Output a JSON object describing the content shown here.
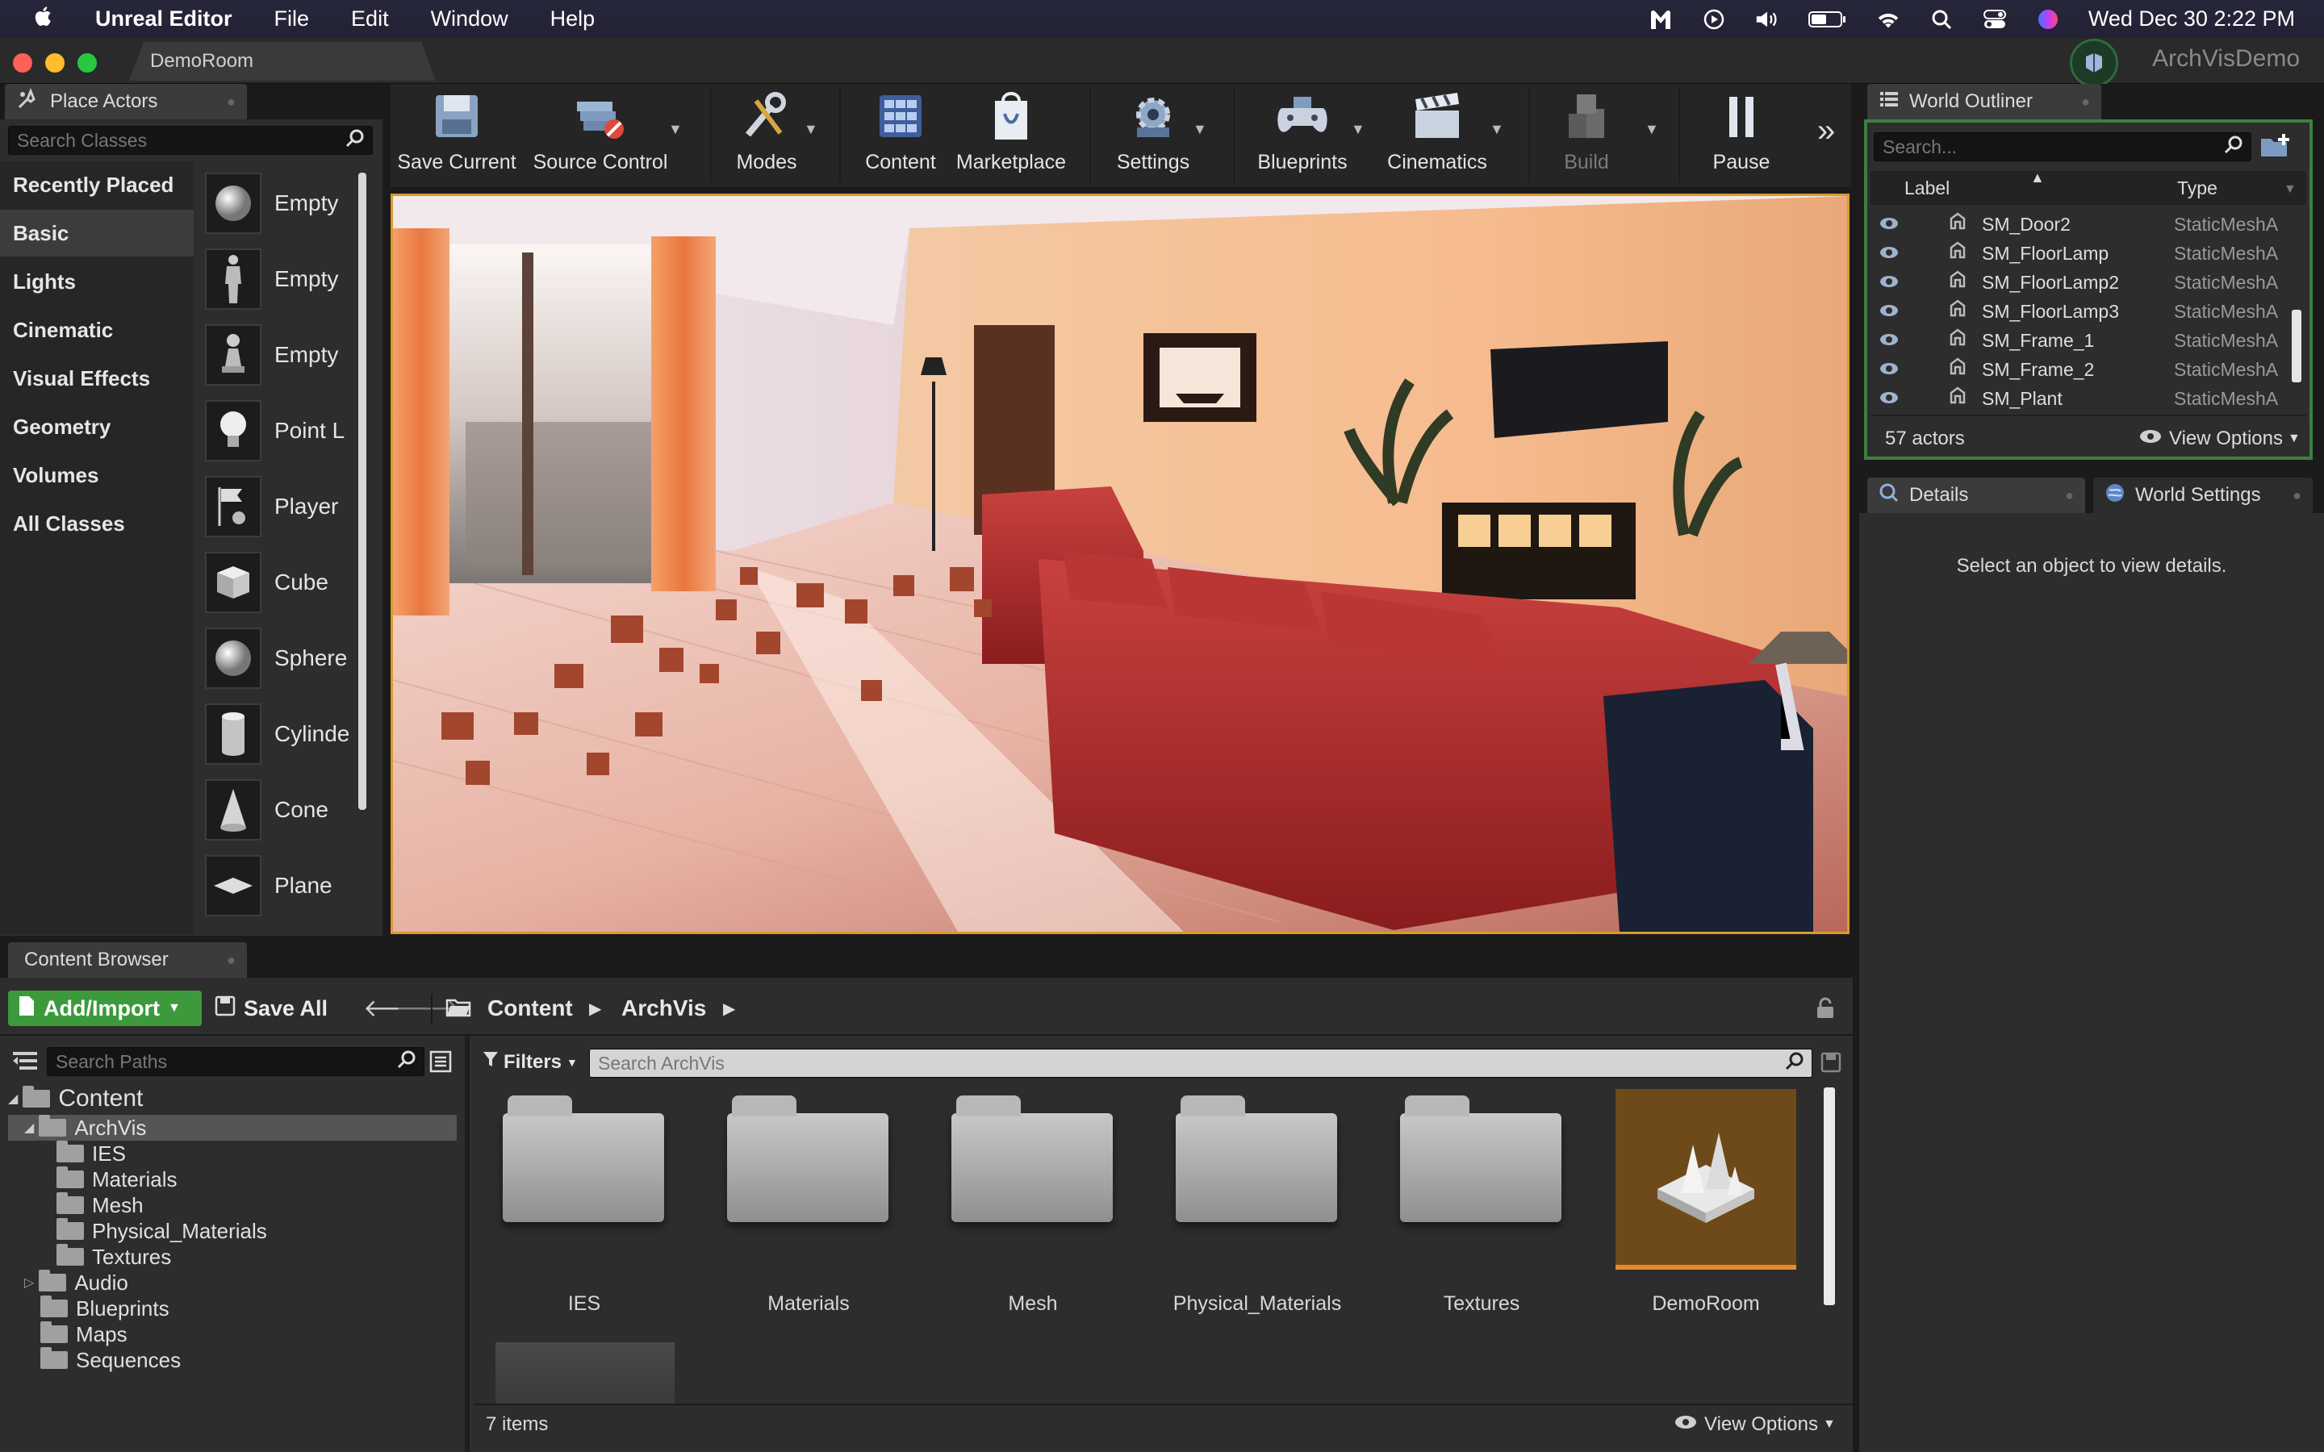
{
  "menubar": {
    "app": "Unreal Editor",
    "items": [
      "File",
      "Edit",
      "Window",
      "Help"
    ],
    "datetime": "Wed Dec 30  2:22 PM"
  },
  "window": {
    "doc_tab": "DemoRoom",
    "project": "ArchVisDemo"
  },
  "place_actors": {
    "tab": "Place Actors",
    "search_placeholder": "Search Classes",
    "categories": [
      "Recently Placed",
      "Basic",
      "Lights",
      "Cinematic",
      "Visual Effects",
      "Geometry",
      "Volumes",
      "All Classes"
    ],
    "selected_category": "Basic",
    "items": [
      "Empty",
      "Empty",
      "Empty",
      "Point L",
      "Player",
      "Cube",
      "Sphere",
      "Cylinde",
      "Cone",
      "Plane"
    ]
  },
  "toolbar": {
    "save": "Save Current",
    "source": "Source Control",
    "modes": "Modes",
    "content": "Content",
    "marketplace": "Marketplace",
    "settings": "Settings",
    "blueprints": "Blueprints",
    "cinematics": "Cinematics",
    "build": "Build",
    "pause": "Pause"
  },
  "outliner": {
    "tab": "World Outliner",
    "search_placeholder": "Search...",
    "col_label": "Label",
    "col_type": "Type",
    "rows": [
      {
        "name": "SM_Door2",
        "type": "StaticMeshA"
      },
      {
        "name": "SM_FloorLamp",
        "type": "StaticMeshA"
      },
      {
        "name": "SM_FloorLamp2",
        "type": "StaticMeshA"
      },
      {
        "name": "SM_FloorLamp3",
        "type": "StaticMeshA"
      },
      {
        "name": "SM_Frame_1",
        "type": "StaticMeshA"
      },
      {
        "name": "SM_Frame_2",
        "type": "StaticMeshA"
      },
      {
        "name": "SM_Plant",
        "type": "StaticMeshA"
      }
    ],
    "count": "57 actors",
    "view_options": "View Options"
  },
  "details": {
    "tab": "Details",
    "world_settings_tab": "World Settings",
    "empty_msg": "Select an object to view details."
  },
  "content_browser": {
    "tab": "Content Browser",
    "add_import": "Add/Import",
    "save_all": "Save All",
    "path": [
      "Content",
      "ArchVis"
    ],
    "search_paths_placeholder": "Search Paths",
    "filters": "Filters",
    "search_assets_placeholder": "Search ArchVis",
    "tree": {
      "root": "Content",
      "archvis": "ArchVis",
      "archvis_children": [
        "IES",
        "Materials",
        "Mesh",
        "Physical_Materials",
        "Textures"
      ],
      "others": [
        "Audio",
        "Blueprints",
        "Maps",
        "Sequences"
      ]
    },
    "assets": [
      "IES",
      "Materials",
      "Mesh",
      "Physical_Materials",
      "Textures",
      "DemoRoom"
    ],
    "item_count": "7 items",
    "view_options": "View Options"
  },
  "colors": {
    "accent_orange": "#d99a2b",
    "add_button_green": "#3c9a3c",
    "outliner_border_green": "#3f7e3f"
  }
}
